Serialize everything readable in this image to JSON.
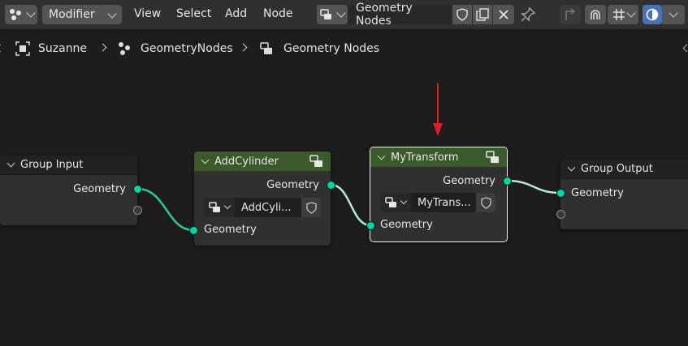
{
  "header": {
    "editor_type_icon": "node-editor-icon",
    "dropdown_label": "Modifier",
    "menu": [
      "View",
      "Select",
      "Add",
      "Node"
    ],
    "node_group_name": "Geometry Nodes",
    "icons": [
      "node-tree-icon",
      "fake-user-shield-icon",
      "duplicate-icon",
      "unlink-x-icon",
      "pin-icon",
      "parent-node-tree-icon",
      "snap-magnet-icon",
      "snap-grid-icon",
      "overlay-icon"
    ]
  },
  "breadcrumb": {
    "items": [
      "Suzanne",
      "GeometryNodes",
      "Geometry Nodes"
    ]
  },
  "nodes": {
    "group_input": {
      "title": "Group Input",
      "output": "Geometry"
    },
    "add_cylinder": {
      "title": "AddCylinder",
      "output": "Geometry",
      "group_name": "AddCyli...",
      "input": "Geometry"
    },
    "my_transform": {
      "title": "MyTransform",
      "output": "Geometry",
      "group_name": "MyTrans...",
      "input": "Geometry"
    },
    "group_output": {
      "title": "Group Output",
      "input": "Geometry"
    }
  },
  "colors": {
    "socket_geometry": "#00d6a3",
    "node_header_group": "#3b5a2b",
    "annotation_arrow": "#e01e1e"
  }
}
